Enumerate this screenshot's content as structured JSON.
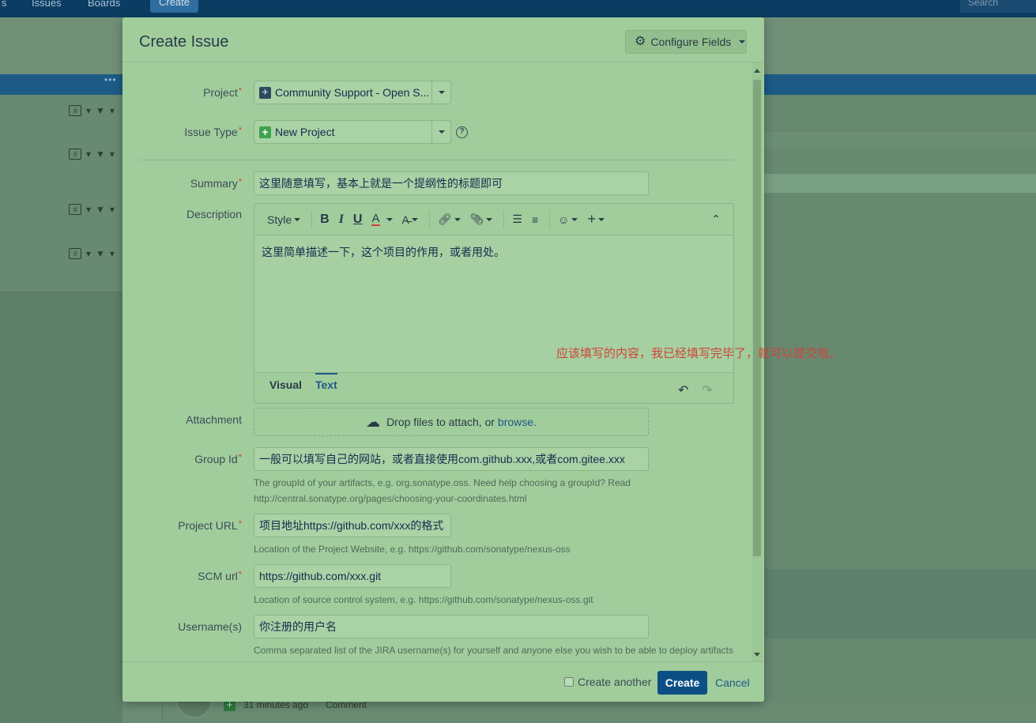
{
  "background": {
    "nav": [
      "s",
      "Issues",
      "Boards"
    ],
    "create_label": "Create",
    "search_placeholder": "Search",
    "activity_time": "31 minutes ago",
    "activity_action": "Comment"
  },
  "dialog": {
    "title": "Create Issue",
    "configure_label": "Configure Fields",
    "fields": {
      "project": {
        "label": "Project",
        "value": "Community Support - Open S..."
      },
      "issue_type": {
        "label": "Issue Type",
        "value": "New Project"
      },
      "summary": {
        "label": "Summary",
        "value": "这里随意填写，基本上就是一个提纲性的标题即可"
      },
      "description": {
        "label": "Description",
        "content": "这里简单描述一下，这个项目的作用，或者用处。",
        "toolbar": {
          "style_label": "Style"
        },
        "tabs": [
          "Visual",
          "Text"
        ],
        "active_tab": "Text"
      },
      "attachment": {
        "label": "Attachment",
        "text": "Drop files to attach, or",
        "link": "browse."
      },
      "group_id": {
        "label": "Group Id",
        "value": "一般可以填写自己的网站，或者直接使用com.github.xxx,或者com.gitee.xxx",
        "help_line1": "The groupId of your artifacts, e.g. org.sonatype.oss. Need help choosing a groupId? Read",
        "help_line2": "http://central.sonatype.org/pages/choosing-your-coordinates.html"
      },
      "project_url": {
        "label": "Project URL",
        "value": "项目地址https://github.com/xxx的格式",
        "help": "Location of the Project Website, e.g. https://github.com/sonatype/nexus-oss"
      },
      "scm_url": {
        "label": "SCM url",
        "value": "https://github.com/xxx.git",
        "help": "Location of source control system, e.g. https://github.com/sonatype/nexus-oss.git"
      },
      "usernames": {
        "label": "Username(s)",
        "value": "你注册的用户名",
        "help": "Comma separated list of the JIRA username(s) for yourself and anyone else you wish to be able to deploy artifacts"
      }
    },
    "annotation": "应该填写的内容，我已经填写完毕了，就可以提交啦。",
    "footer": {
      "create_another": "Create another",
      "create_button": "Create",
      "cancel_link": "Cancel"
    }
  },
  "colors": {
    "accent": "#0b4f85",
    "required": "#d04437",
    "dialog_bg": "#a1cd9d"
  }
}
